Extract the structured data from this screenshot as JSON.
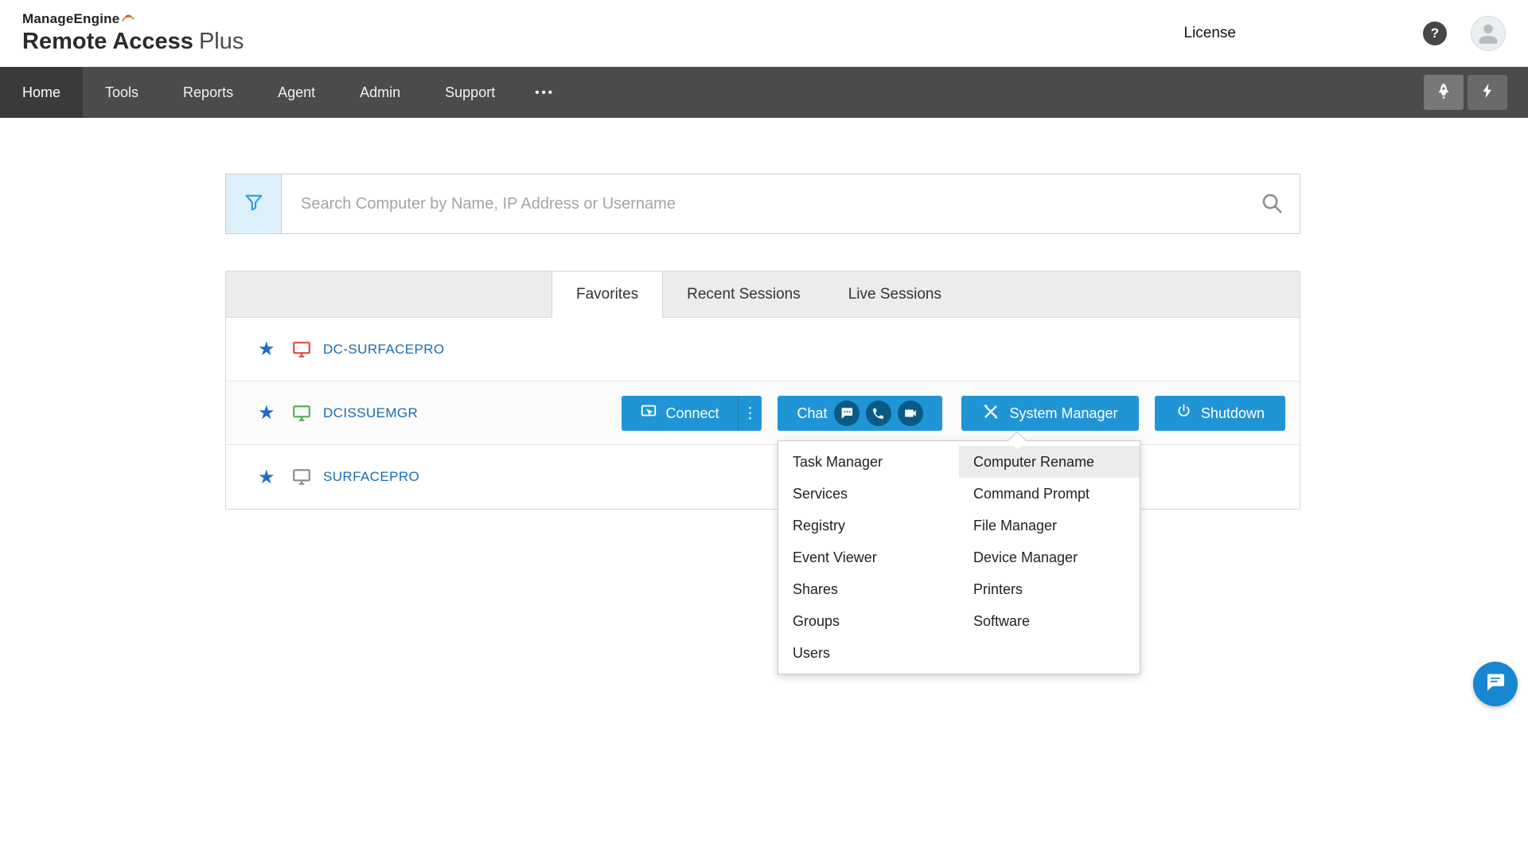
{
  "brand": {
    "company": "ManageEngine",
    "product_strong": "Remote Access",
    "product_light": "Plus"
  },
  "header": {
    "license": "License",
    "help_glyph": "?"
  },
  "nav": {
    "items": [
      "Home",
      "Tools",
      "Reports",
      "Agent",
      "Admin",
      "Support"
    ],
    "more": "•••"
  },
  "search": {
    "placeholder": "Search Computer by Name, IP Address or Username"
  },
  "tabs": [
    "Favorites",
    "Recent Sessions",
    "Live Sessions"
  ],
  "computers": [
    {
      "name": "DC-SURFACEPRO",
      "color": "#e2453c"
    },
    {
      "name": "DCISSUEMGR",
      "color": "#4caf50"
    },
    {
      "name": "SURFACEPRO",
      "color": "#8a8a8a"
    }
  ],
  "actions": {
    "connect": "Connect",
    "connect_more": "⋮",
    "chat": "Chat",
    "system_manager": "System Manager",
    "shutdown": "Shutdown"
  },
  "menu": {
    "left": [
      "Task Manager",
      "Services",
      "Registry",
      "Event Viewer",
      "Shares",
      "Groups",
      "Users"
    ],
    "right": [
      "Computer Rename",
      "Command Prompt",
      "File Manager",
      "Device Manager",
      "Printers",
      "Software"
    ]
  },
  "colors": {
    "accent": "#2095d5",
    "accent_dark": "#0a5a85",
    "nav_bg": "#4b4b4b",
    "link": "#1a6cb3",
    "star": "#1b6fc9",
    "fab": "#1787d1"
  }
}
